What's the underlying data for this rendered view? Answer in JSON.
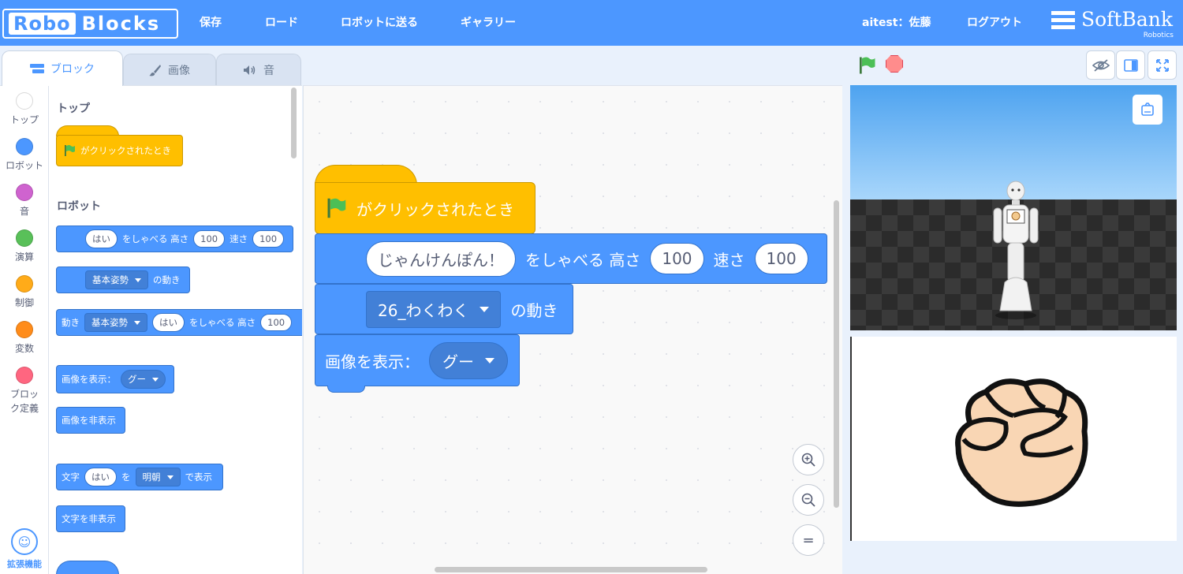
{
  "app": {
    "logo_part1": "Robo",
    "logo_part2": "Blocks",
    "brand_name": "SoftBank",
    "brand_sub": "Robotics"
  },
  "nav": {
    "save": "保存",
    "load": "ロード",
    "send_to_robot": "ロボットに送る",
    "gallery": "ギャラリー",
    "user": "aitest：佐藤",
    "logout": "ログアウト"
  },
  "tabs": [
    {
      "label": "ブロック",
      "icon": "blocks-icon",
      "active": true
    },
    {
      "label": "画像",
      "icon": "brush-icon",
      "active": false
    },
    {
      "label": "音",
      "icon": "speaker-icon",
      "active": false
    }
  ],
  "categories": [
    {
      "label": "トップ",
      "color": "#ffffff"
    },
    {
      "label": "ロボット",
      "color": "#4c97ff"
    },
    {
      "label": "音",
      "color": "#cf63cf"
    },
    {
      "label": "演算",
      "color": "#59c059"
    },
    {
      "label": "制御",
      "color": "#ffab19"
    },
    {
      "label": "変数",
      "color": "#ff8c1a"
    },
    {
      "label": "ブロック定義",
      "color": "#ff6680"
    }
  ],
  "extension_label": "拡張機能",
  "palette": {
    "section_top": "トップ",
    "section_robot": "ロボット",
    "when_clicked": "がクリックされたとき",
    "say": {
      "text": "はい",
      "label1": "をしゃべる 高さ",
      "height": "100",
      "label2": "速さ",
      "speed": "100"
    },
    "motion": {
      "value": "基本姿勢",
      "label": "の動き"
    },
    "motion_say": {
      "label0": "動き",
      "value": "基本姿勢",
      "text": "はい",
      "label1": "をしゃべる 高さ",
      "height": "100"
    },
    "show_image": {
      "label": "画像を表示：",
      "value": "グー"
    },
    "hide_image": "画像を非表示",
    "show_text": {
      "label0": "文字",
      "text": "はい",
      "label1": "を",
      "font": "明朝",
      "label2": "で表示"
    },
    "hide_text": "文字を非表示"
  },
  "workspace": {
    "when_clicked": "がクリックされたとき",
    "say": {
      "text": "じゃんけんぽん！",
      "label1": "をしゃべる 高さ",
      "height": "100",
      "label2": "速さ",
      "speed": "100"
    },
    "motion": {
      "value": "26_わくわく",
      "label": "の動き"
    },
    "show_image": {
      "label": "画像を表示：",
      "value": "グー"
    },
    "zoom_reset": "="
  },
  "colors": {
    "header_bg": "#4c97ff",
    "robot_block": "#4c97ff",
    "event_block": "#ffbf00",
    "flag_green": "#4cbf56",
    "stop_red": "#ff8c8c"
  }
}
